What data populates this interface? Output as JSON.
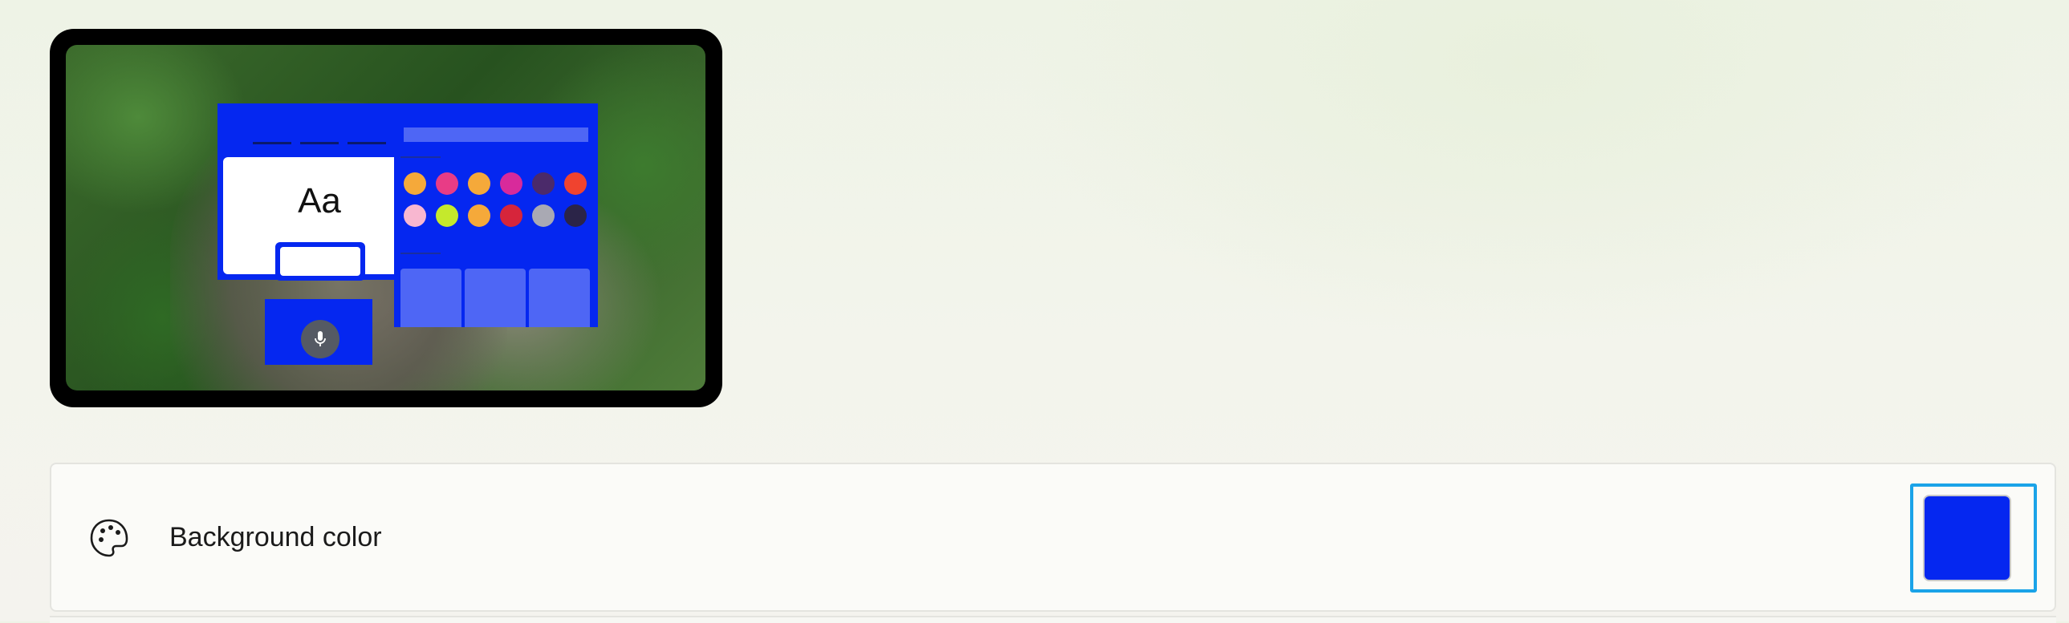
{
  "preview": {
    "sample_text": "Aa",
    "accent_color": "#0527f0",
    "tile_color": "#4e66f5",
    "palette_dots": [
      "#f5a93a",
      "#e83c86",
      "#f5a93a",
      "#d82a9b",
      "#4b2a6a",
      "#f0432f",
      "#f8b7d0",
      "#c5e92c",
      "#f5a93a",
      "#d6253b",
      "#a9a9b3",
      "#2b2448"
    ],
    "mic_icon": "microphone-icon",
    "background_image": "cat-in-grass-wallpaper"
  },
  "setting": {
    "icon": "palette-icon",
    "label": "Background color",
    "current_color": "#0527f0"
  }
}
